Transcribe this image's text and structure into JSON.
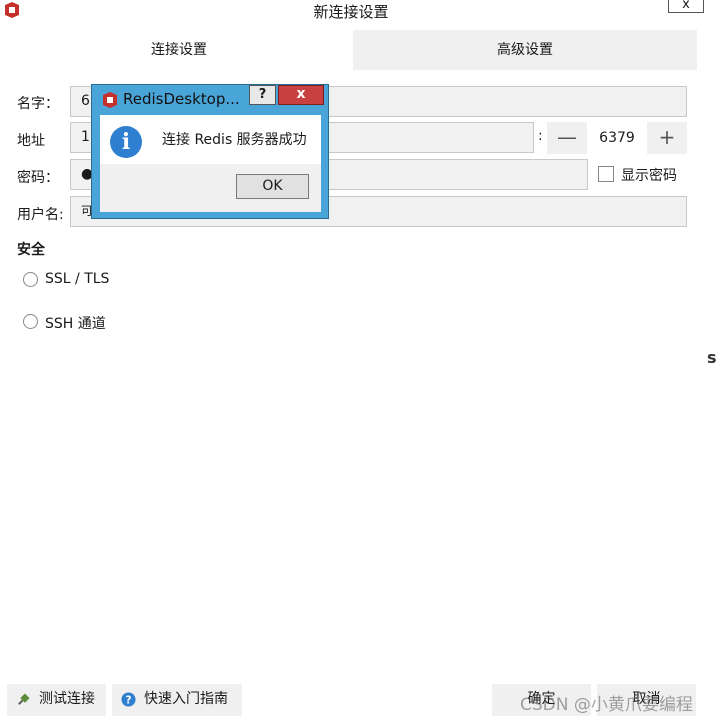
{
  "window": {
    "title": "新连接设置",
    "close_glyph": "x"
  },
  "tabs": [
    {
      "label": "连接设置",
      "active": true
    },
    {
      "label": "高级设置",
      "active": false
    }
  ],
  "form": {
    "name_label": "名字：",
    "name_value": "63",
    "address_label": "地址",
    "address_value": "17",
    "colon": ":",
    "port_value": "6379",
    "port_minus": "—",
    "port_plus": "+",
    "password_label": "密码：",
    "password_value": "●",
    "show_password_label": "显示密码",
    "username_label": "用户名:",
    "username_value": "可"
  },
  "security": {
    "heading": "安全",
    "options": [
      {
        "label": "SSL / TLS"
      },
      {
        "label": "SSH 通道"
      }
    ]
  },
  "bottom": {
    "test_label": "测试连接",
    "guide_label": "快速入门指南",
    "ok_label": "确定",
    "cancel_label": "取消"
  },
  "dialog": {
    "title": "RedisDesktop...",
    "help_glyph": "?",
    "close_glyph": "x",
    "info_glyph": "i",
    "message": "连接 Redis 服务器成功",
    "ok_label": "OK"
  },
  "watermark": "CSDN @小黄爪要编程",
  "edge_glyph": "s",
  "icons": {
    "app": "redis-logo-icon",
    "info": "info-icon",
    "test": "plug-icon",
    "guide": "help-circle-icon"
  },
  "colors": {
    "dialog_frame": "#49a4d7",
    "dialog_close": "#c94040",
    "info_blue": "#2f7fd1",
    "redis_red": "#c6302b"
  }
}
